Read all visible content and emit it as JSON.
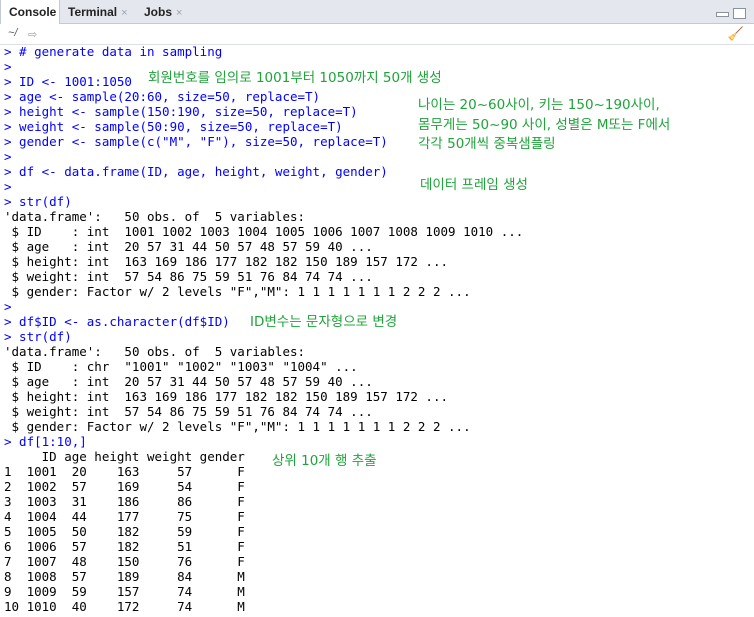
{
  "tabs": [
    {
      "label": "Console"
    },
    {
      "label": "Terminal",
      "close": "×"
    },
    {
      "label": "Jobs",
      "close": "×"
    }
  ],
  "path": "~/",
  "icons": {
    "path_nav": "forward-arrow-icon",
    "clear": "broom-icon",
    "minimize": "minimize-icon",
    "maximize": "maximize-icon"
  },
  "colors": {
    "command": "#0000ff",
    "annotation": "#1fa33a"
  },
  "console_lines": [
    {
      "type": "cmd",
      "text": "> # generate data in sampling"
    },
    {
      "type": "cmd",
      "text": ">"
    },
    {
      "type": "cmd",
      "text": "> ID <- 1001:1050"
    },
    {
      "type": "cmd",
      "text": "> age <- sample(20:60, size=50, replace=T)"
    },
    {
      "type": "cmd",
      "text": "> height <- sample(150:190, size=50, replace=T)"
    },
    {
      "type": "cmd",
      "text": "> weight <- sample(50:90, size=50, replace=T)"
    },
    {
      "type": "cmd",
      "text": "> gender <- sample(c(\"M\", \"F\"), size=50, replace=T)"
    },
    {
      "type": "cmd",
      "text": ">"
    },
    {
      "type": "cmd",
      "text": "> df <- data.frame(ID, age, height, weight, gender)"
    },
    {
      "type": "cmd",
      "text": ">"
    },
    {
      "type": "cmd",
      "text": "> str(df)"
    },
    {
      "type": "out",
      "text": "'data.frame':\t50 obs. of  5 variables:"
    },
    {
      "type": "out",
      "text": " $ ID    : int  1001 1002 1003 1004 1005 1006 1007 1008 1009 1010 ..."
    },
    {
      "type": "out",
      "text": " $ age   : int  20 57 31 44 50 57 48 57 59 40 ..."
    },
    {
      "type": "out",
      "text": " $ height: int  163 169 186 177 182 182 150 189 157 172 ..."
    },
    {
      "type": "out",
      "text": " $ weight: int  57 54 86 75 59 51 76 84 74 74 ..."
    },
    {
      "type": "out",
      "text": " $ gender: Factor w/ 2 levels \"F\",\"M\": 1 1 1 1 1 1 1 2 2 2 ..."
    },
    {
      "type": "cmd",
      "text": ">"
    },
    {
      "type": "cmd",
      "text": "> df$ID <- as.character(df$ID)"
    },
    {
      "type": "cmd",
      "text": "> str(df)"
    },
    {
      "type": "out",
      "text": "'data.frame':\t50 obs. of  5 variables:"
    },
    {
      "type": "out",
      "text": " $ ID    : chr  \"1001\" \"1002\" \"1003\" \"1004\" ..."
    },
    {
      "type": "out",
      "text": " $ age   : int  20 57 31 44 50 57 48 57 59 40 ..."
    },
    {
      "type": "out",
      "text": " $ height: int  163 169 186 177 182 182 150 189 157 172 ..."
    },
    {
      "type": "out",
      "text": " $ weight: int  57 54 86 75 59 51 76 84 74 74 ..."
    },
    {
      "type": "out",
      "text": " $ gender: Factor w/ 2 levels \"F\",\"M\": 1 1 1 1 1 1 1 2 2 2 ..."
    },
    {
      "type": "cmd",
      "text": "> df[1:10,]"
    },
    {
      "type": "out",
      "text": "     ID age height weight gender"
    },
    {
      "type": "out",
      "text": "1  1001  20    163     57      F"
    },
    {
      "type": "out",
      "text": "2  1002  57    169     54      F"
    },
    {
      "type": "out",
      "text": "3  1003  31    186     86      F"
    },
    {
      "type": "out",
      "text": "4  1004  44    177     75      F"
    },
    {
      "type": "out",
      "text": "5  1005  50    182     59      F"
    },
    {
      "type": "out",
      "text": "6  1006  57    182     51      F"
    },
    {
      "type": "out",
      "text": "7  1007  48    150     76      F"
    },
    {
      "type": "out",
      "text": "8  1008  57    189     84      M"
    },
    {
      "type": "out",
      "text": "9  1009  59    157     74      M"
    },
    {
      "type": "out",
      "text": "10 1010  40    172     74      M"
    }
  ],
  "annotations": {
    "id_note": "회원번호를 임의로 1001부터 1050까지 50개 생성",
    "sampling_note_1": "나이는 20~60사이, 키는 150~190사이,",
    "sampling_note_2": "몸무게는 50~90 사이, 성별은 M또는 F에서",
    "sampling_note_3": "각각 50개씩 중복샘플링",
    "df_note": "데이터 프레임 생성",
    "char_note": "ID변수는 문자형으로 변경",
    "head_note": "상위 10개 행 추출"
  }
}
